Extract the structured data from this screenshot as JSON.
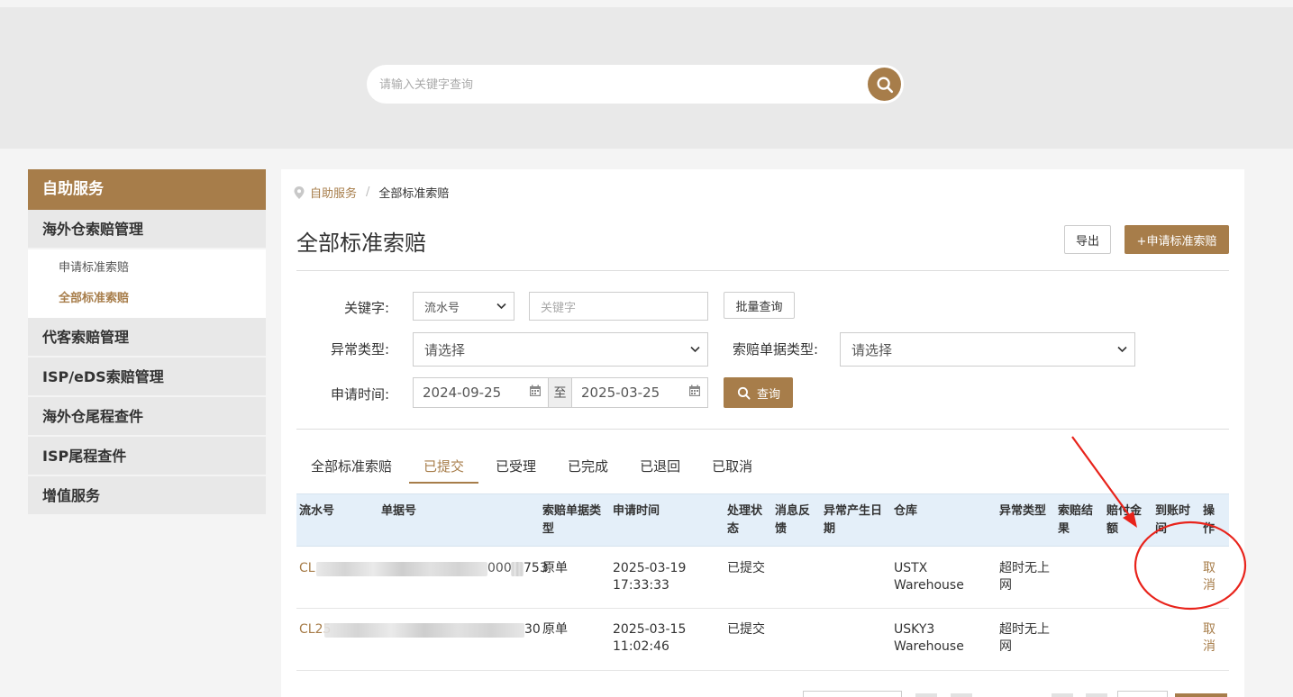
{
  "search": {
    "placeholder": "请输入关键字查询"
  },
  "sidebar": {
    "title": "自助服务",
    "items": [
      {
        "label": "海外仓索赔管理",
        "children": [
          {
            "label": "申请标准索赔"
          },
          {
            "label": "全部标准索赔",
            "active": true
          }
        ]
      },
      {
        "label": "代客索赔管理"
      },
      {
        "label": "ISP/eDS索赔管理"
      },
      {
        "label": "海外仓尾程查件"
      },
      {
        "label": "ISP尾程查件"
      },
      {
        "label": "增值服务"
      }
    ]
  },
  "breadcrumb": {
    "parent": "自助服务",
    "separator": "/",
    "current": "全部标准索赔"
  },
  "page": {
    "title": "全部标准索赔",
    "export_label": "导出",
    "apply_label": "+申请标准索赔"
  },
  "filters": {
    "keyword_label": "关键字:",
    "keyword_type_value": "流水号",
    "keyword_placeholder": "关键字",
    "batch_label": "批量查询",
    "exception_label": "异常类型:",
    "exception_value": "请选择",
    "doc_type_label": "索赔单据类型:",
    "doc_type_value": "请选择",
    "date_label": "申请时间:",
    "date_from": "2024-09-25",
    "date_sep": "至",
    "date_to": "2025-03-25",
    "query_label": "查询"
  },
  "tabs": [
    {
      "label": "全部标准索赔"
    },
    {
      "label": "已提交",
      "active": true
    },
    {
      "label": "已受理"
    },
    {
      "label": "已完成"
    },
    {
      "label": "已退回"
    },
    {
      "label": "已取消"
    }
  ],
  "table": {
    "headers": [
      "流水号",
      "单据号",
      "索赔单据类型",
      "申请时间",
      "处理状态",
      "消息反馈",
      "异常产生日期",
      "仓库",
      "异常类型",
      "索赔结果",
      "赔付金额",
      "到账时间",
      "操作"
    ],
    "rows": [
      {
        "serial_prefix": "CL",
        "doc_suffix": "000",
        "doc_end": "753",
        "doc_type": "原单",
        "time_date": "2025-03-19",
        "time_clock": "17:33:33",
        "status": "已提交",
        "warehouse": "USTX Warehouse",
        "exception_type": "超时无上网",
        "action": "取消"
      },
      {
        "serial_prefix": "CL25",
        "doc_suffix": "",
        "doc_end": "30",
        "doc_type": "原单",
        "time_date": "2025-03-15",
        "time_clock": "11:02:46",
        "status": "已提交",
        "warehouse": "USKY3 Warehouse",
        "exception_type": "超时无上网",
        "action": "取消"
      }
    ]
  },
  "colors": {
    "accent": "#a77d4a",
    "annotation": "#e8231b",
    "table_header_bg": "#e4eff9"
  }
}
